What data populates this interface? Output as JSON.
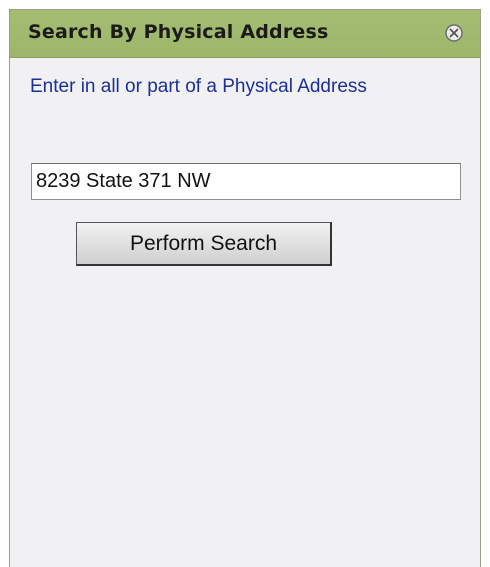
{
  "panel": {
    "title": "Search By Physical Address",
    "close_icon": "close-circle-icon"
  },
  "instruction": "Enter in all or part of a Physical Address",
  "search": {
    "value": "8239 State 371 NW",
    "placeholder": ""
  },
  "button": {
    "label": "Perform Search"
  },
  "colors": {
    "header_bg": "#a1b96f",
    "panel_bg": "#f1f1f3",
    "instruction_text": "#1c2f98"
  }
}
